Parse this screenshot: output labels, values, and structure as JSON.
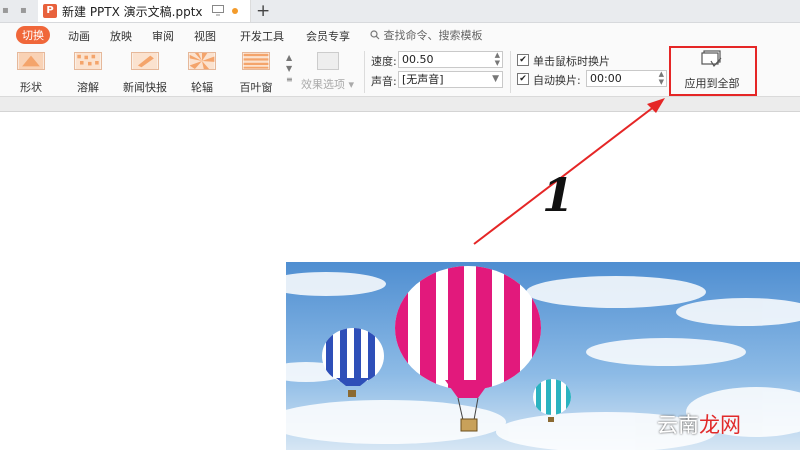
{
  "tab_bar": {
    "doc_logo": "P",
    "doc_title": "新建 PPTX 演示文稿.pptx",
    "new_tab_symbol": "+"
  },
  "menu": {
    "items": [
      "切换",
      "动画",
      "放映",
      "审阅",
      "视图",
      "开发工具",
      "会员专享"
    ],
    "active": "切换",
    "search_placeholder": "查找命令、搜索模板"
  },
  "toolbar": {
    "effects": [
      {
        "label": "形状",
        "icon": "shape-effect-icon"
      },
      {
        "label": "溶解",
        "icon": "dissolve-effect-icon"
      },
      {
        "label": "新闻快报",
        "icon": "newsflash-effect-icon"
      },
      {
        "label": "轮辐",
        "icon": "wheel-effect-icon"
      },
      {
        "label": "百叶窗",
        "icon": "blinds-effect-icon"
      }
    ],
    "effect_options_label": "效果选项",
    "speed_label": "速度:",
    "speed_value": "00.50",
    "sound_label": "声音:",
    "sound_value": "[无声音]",
    "click_advance_label": "单击鼠标时换片",
    "click_advance_checked": true,
    "auto_advance_label": "自动换片:",
    "auto_advance_checked": true,
    "auto_advance_value": "00:00",
    "apply_all_label": "应用到全部"
  },
  "annotation": {
    "step_number": "1",
    "highlight_color": "#e52626"
  },
  "watermark": {
    "part1": "云南",
    "part2": "龙网"
  },
  "colors": {
    "accent": "#f0673a",
    "effect_orange": "#f4a46b"
  }
}
